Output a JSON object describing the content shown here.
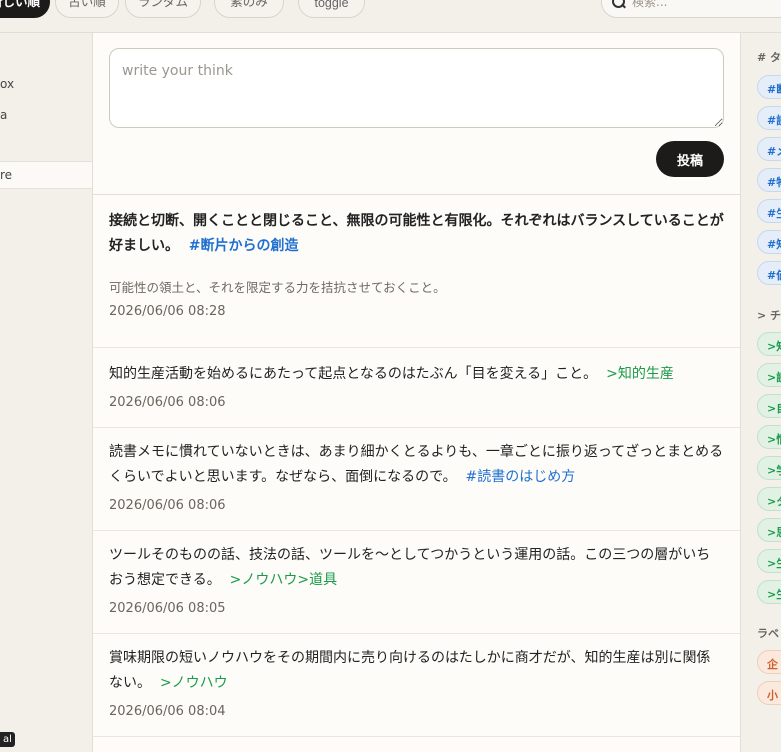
{
  "toolbar": {
    "sort_new": "新しい順",
    "sort_old": "古い順",
    "sort_random": "ランダム",
    "filter_plain": "素のみ",
    "toggle": "toggle"
  },
  "search": {
    "placeholder": "検索..."
  },
  "left": {
    "items": [
      "ox",
      "a",
      "re"
    ],
    "badge": "al"
  },
  "composer": {
    "placeholder": "write your think",
    "submit_label": "投稿"
  },
  "posts": [
    {
      "text": "接続と切断、開くことと閉じること、無限の可能性と有限化。それぞれはバランスしていることが好ましい。",
      "tag": "#断片からの創造",
      "tag_type": "hash",
      "note": "可能性の領土と、それを限定する力を拮抗させておくこと。",
      "date": "2026/06/06 08:28"
    },
    {
      "text": "知的生産活動を始めるにあたって起点となるのはたぶん「目を変える」こと。",
      "tag": ">知的生産",
      "tag_type": "topic",
      "date": "2026/06/06 08:06"
    },
    {
      "text": "読書メモに慣れていないときは、あまり細かくとるよりも、一章ごとに振り返ってざっとまとめるくらいでよいと思います。なぜなら、面倒になるので。",
      "tag": "#読書のはじめ方",
      "tag_type": "hash",
      "date": "2026/06/06 08:06"
    },
    {
      "text": "ツールそのものの話、技法の話、ツールを〜としてつかうという運用の話。この三つの層がいちおう想定できる。",
      "tag": ">ノウハウ>道具",
      "tag_type": "topic",
      "date": "2026/06/06 08:05"
    },
    {
      "text": "賞味期限の短いノウハウをその期間内に売り向けるのはたしかに商才だが、知的生産は別に関係ない。",
      "tag": ">ノウハウ",
      "tag_type": "topic",
      "date": "2026/06/06 08:04"
    }
  ],
  "right": {
    "tags_title": "# タ",
    "tags": [
      "#断",
      "#読",
      "#メ",
      "#物",
      "#生",
      "#知",
      "#価"
    ],
    "topics_title": "> チ",
    "topics": [
      ">知",
      ">読",
      ">自",
      ">情",
      ">学",
      ">タ",
      ">思",
      ">生",
      ">生"
    ],
    "labels_title": "ラベ",
    "labels": [
      "企",
      "小"
    ]
  },
  "colors": {
    "accent_dark": "#1d1b19",
    "hash_tag": "#1f6fd1",
    "topic_tag": "#1a9a4a",
    "label_tag": "#d0602a"
  }
}
